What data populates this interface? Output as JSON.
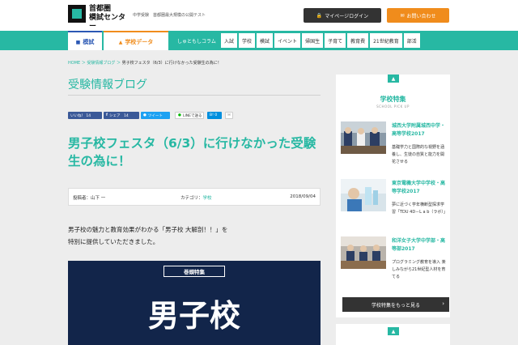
{
  "header": {
    "logo_line1": "首都圏",
    "logo_line2": "模試センター",
    "tagline": "中学受験　首都圏最大規模の公開テスト",
    "mypage_label": "マイページログイン",
    "contact_label": "お問い合わせ"
  },
  "nav": {
    "tab_mogi": "模試",
    "tab_data": "学校データ",
    "column_link": "しゅともしコラム",
    "items": [
      "入試",
      "学校",
      "模試",
      "イベント",
      "帰国生",
      "子育て",
      "教育費",
      "21世紀教育",
      "部活"
    ]
  },
  "breadcrumb": {
    "home": "HOME",
    "sep": "＞",
    "blog": "受験情報ブログ",
    "current": "男子校フェスタ（6/3）に行けなかった受験生の為に！"
  },
  "blog_title": "受験情報ブログ",
  "share": {
    "like": "いいね！ 14",
    "facebook": "シェア　14",
    "tweet": "ツイート",
    "line": "LINEで送る",
    "hatena": "B! 0",
    "mail": "✉"
  },
  "article": {
    "title": "男子校フェスタ（6/3）に行けなかった受験生の為に！",
    "author": "投稿者：山下 一",
    "category_label": "カテゴリ：",
    "category": "学校",
    "date": "2018/09/04",
    "body_line1": "男子校の魅力と教育効果がわかる「男子校 大解剖！！」を",
    "body_line2": "特別に提供していただきました。",
    "banner_label": "巻頭特集",
    "banner_big": "男子校"
  },
  "sidebar": {
    "title": "学校特集",
    "subtitle": "SCHOOL PICK UP",
    "items": [
      {
        "name": "城西大学附属城西中学・高等学校2017",
        "desc": "基礎学力と国際的な視野を涵養し、生徒の自質と能力を開花させる"
      },
      {
        "name": "東京電機大学中学校・高等学校2017",
        "desc": "夢に近づく学年横断型探求学習「TDU 4D－L a b（ラボ）」"
      },
      {
        "name": "和洋女子大学中学部・高等部2017",
        "desc": "プログラミング教育を導入 楽しみながら21世紀型人材を育てる"
      }
    ],
    "more_label": "学校特集をもっと見る"
  },
  "colors": {
    "accent": "#27b8a3",
    "orange": "#f08c1c",
    "navy": "#12254a"
  }
}
